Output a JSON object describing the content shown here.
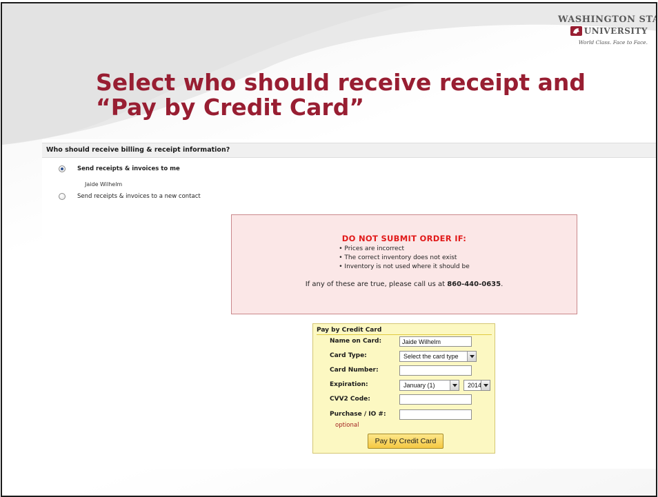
{
  "logo": {
    "line1": "WASHINGTON STATE",
    "line2": "UNIVERSITY",
    "tagline": "World Class. Face to Face."
  },
  "slide_title": "Select who should receive receipt and “Pay by Credit Card”",
  "billing": {
    "header": "Who should receive billing & receipt information?",
    "option_me": "Send receipts & invoices to me",
    "contact_name": "Jaide Wilhelm",
    "option_new": "Send receipts & invoices to a new contact",
    "selected": "me"
  },
  "warning": {
    "title": "DO NOT SUBMIT ORDER IF:",
    "items": [
      "Prices are incorrect",
      "The correct inventory does not exist",
      "Inventory is not used where it should be"
    ],
    "call_prefix": "If any of these are true, please call us at ",
    "phone": "860-440-0635",
    "call_suffix": "."
  },
  "credit_card": {
    "title": "Pay by Credit Card",
    "name_label": "Name on Card:",
    "name_value": "Jaide Wilhelm",
    "type_label": "Card Type:",
    "type_value": "Select the card type",
    "number_label": "Card Number:",
    "number_value": "",
    "expiration_label": "Expiration:",
    "exp_month": "January (1)",
    "exp_year": "2014",
    "cvv_label": "CVV2 Code:",
    "cvv_value": "",
    "po_label": "Purchase / IO #:",
    "po_optional": "optional",
    "po_value": "",
    "submit_label": "Pay by Credit Card"
  },
  "colors": {
    "brand_crimson": "#981e32",
    "warning_red": "#e11a1a",
    "warning_bg": "#fbe7e7",
    "cc_panel_bg": "#fcf8c2",
    "button_gold": "#f5c842"
  }
}
